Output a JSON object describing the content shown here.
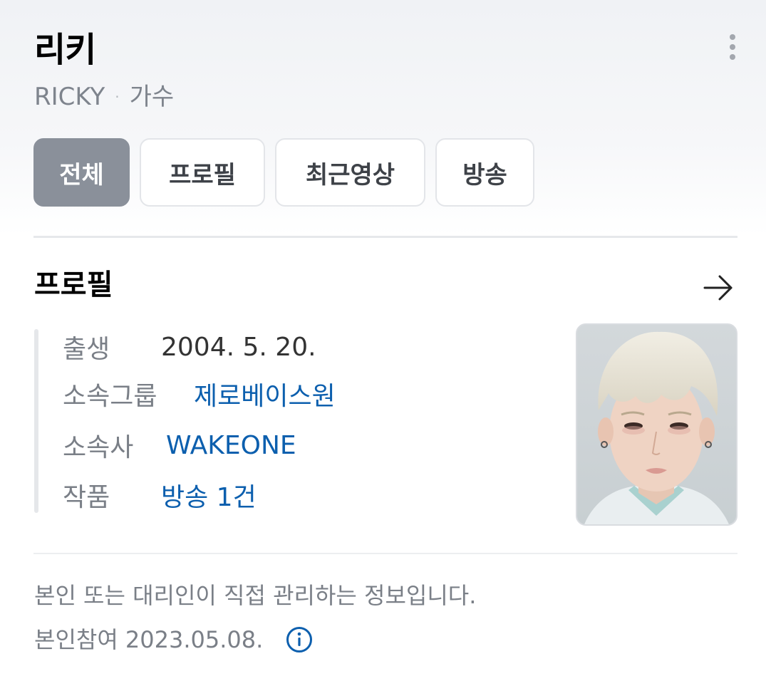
{
  "header": {
    "title": "리키",
    "subtitle_name": "RICKY",
    "subtitle_separator": "·",
    "subtitle_role": "가수",
    "more_icon": "more-vertical-icon"
  },
  "tabs": [
    {
      "label": "전체",
      "active": true
    },
    {
      "label": "프로필",
      "active": false
    },
    {
      "label": "최근영상",
      "active": false
    },
    {
      "label": "방송",
      "active": false
    }
  ],
  "profile": {
    "section_title": "프로필",
    "arrow_icon": "arrow-right-icon",
    "rows": [
      {
        "label": "출생",
        "value": "2004. 5. 20."
      },
      {
        "label": "소속그룹",
        "value": "제로베이스원"
      },
      {
        "label": "소속사",
        "value": "WAKEONE"
      },
      {
        "label": "작품",
        "value": "방송 1건"
      }
    ],
    "photo_icon": "profile-photo"
  },
  "footer": {
    "note": "본인 또는 대리인이 직접 관리하는 정보입니다.",
    "participation": "본인참여 2023.05.08.",
    "info_icon": "info-icon"
  },
  "colors": {
    "accent_link": "#0c5fae",
    "active_tab_bg": "#8a909a",
    "muted_text": "#7a7f87"
  }
}
